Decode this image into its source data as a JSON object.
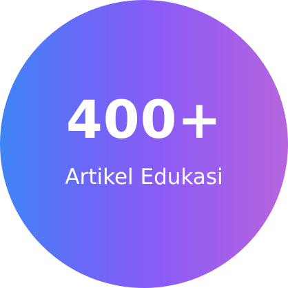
{
  "badge": {
    "number": "400+",
    "label": "Artikel Edukasi"
  },
  "colors": {
    "gradient_start": "#3f84f4",
    "gradient_mid": "#8a5cf5",
    "gradient_end": "#b664dd",
    "text": "#ffffff"
  }
}
